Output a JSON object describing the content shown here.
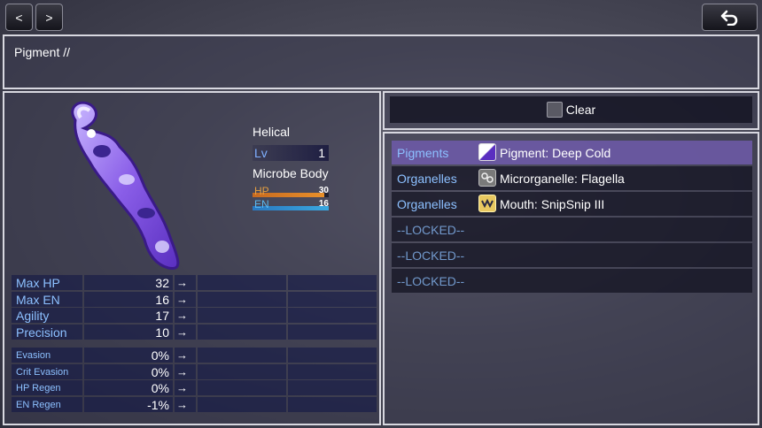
{
  "toolbar": {
    "prev_label": "<",
    "next_label": ">",
    "back_icon": "return-arrow-icon"
  },
  "help": {
    "text": "Pigment //"
  },
  "actor": {
    "name": "Helical",
    "lv_label": "Lv",
    "level": "1",
    "class_name": "Microbe Body",
    "hp_label": "HP",
    "hp_value": "30",
    "hp_fraction": 0.94,
    "en_label": "EN",
    "en_value": "16",
    "en_fraction": 1.0
  },
  "params": [
    {
      "label": "Max HP",
      "value": "32",
      "arrow": "→"
    },
    {
      "label": "Max EN",
      "value": "16",
      "arrow": "→"
    },
    {
      "label": "Agility",
      "value": "17",
      "arrow": "→"
    },
    {
      "label": "Precision",
      "value": "10",
      "arrow": "→"
    }
  ],
  "xparams": [
    {
      "label": "Evasion",
      "value": "0%",
      "arrow": "→"
    },
    {
      "label": "Crit Evasion",
      "value": "0%",
      "arrow": "→"
    },
    {
      "label": "HP Regen",
      "value": "0%",
      "arrow": "→"
    },
    {
      "label": "EN Regen",
      "value": "-1%",
      "arrow": "→"
    }
  ],
  "clear": {
    "label": "Clear"
  },
  "slots": [
    {
      "category": "Pigments",
      "item": "Pigment: Deep Cold",
      "icon": "pigment-icon",
      "selected": true
    },
    {
      "category": "Organelles",
      "item": "Microrganelle: Flagella",
      "icon": "organelle-icon",
      "selected": false
    },
    {
      "category": "Organelles",
      "item": "Mouth: SnipSnip III",
      "icon": "mouth-icon",
      "selected": false
    }
  ],
  "locked_slots": [
    "--LOCKED--",
    "--LOCKED--",
    "--LOCKED--"
  ],
  "colors": {
    "hp_bar": "#e8902a",
    "en_bar": "#3aa8e0",
    "system_text": "#8cc0ff",
    "selected_row": "#6e5aaa"
  }
}
